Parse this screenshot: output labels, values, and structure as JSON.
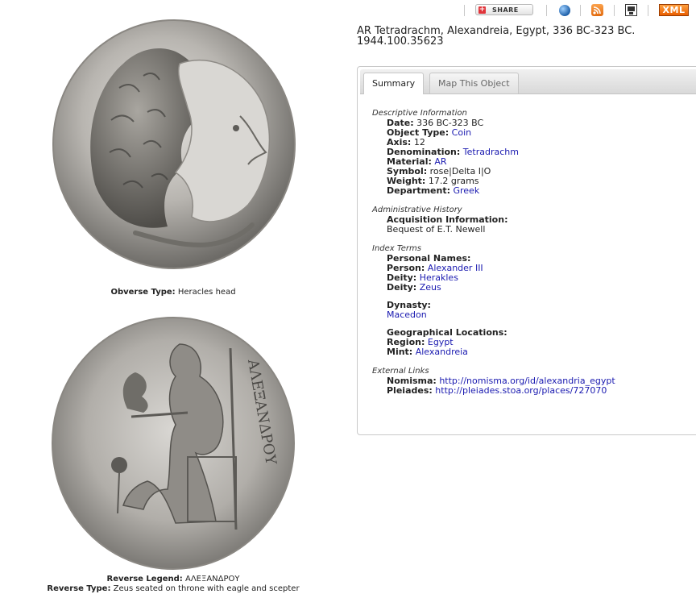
{
  "toolbar": {
    "share_label": "SHARE",
    "xml_label": "XML",
    "icons": [
      "share-icon",
      "globe-icon",
      "rss-icon",
      "kml-icon",
      "xml-icon"
    ]
  },
  "object": {
    "title": "AR Tetradrachm, Alexandreia, Egypt, 336 BC-323 BC.",
    "accession": "1944.100.35623"
  },
  "images": {
    "obverse_caption_label": "Obverse Type:",
    "obverse_caption_value": "Heracles head",
    "reverse_legend_label": "Reverse Legend:",
    "reverse_legend_value": "ΑΛΕΞΑΝΔΡΟΥ",
    "reverse_type_label": "Reverse Type:",
    "reverse_type_value": "Zeus seated on throne with eagle and scepter"
  },
  "tabs": [
    {
      "label": "Summary",
      "active": true
    },
    {
      "label": "Map This Object",
      "active": false
    }
  ],
  "summary": {
    "descriptive": {
      "heading": "Descriptive Information",
      "date_label": "Date:",
      "date": "336 BC-323 BC",
      "object_type_label": "Object Type:",
      "object_type": "Coin",
      "axis_label": "Axis:",
      "axis": "12",
      "denomination_label": "Denomination:",
      "denomination": "Tetradrachm",
      "material_label": "Material:",
      "material": "AR",
      "symbol_label": "Symbol:",
      "symbol": "rose|Delta I|O",
      "weight_label": "Weight:",
      "weight": "17.2 grams",
      "department_label": "Department:",
      "department": "Greek"
    },
    "administrative": {
      "heading": "Administrative History",
      "acquisition_label": "Acquisition Information:",
      "acquisition": "Bequest of E.T. Newell"
    },
    "index_terms": {
      "heading": "Index Terms",
      "personal_names_label": "Personal Names:",
      "person_label": "Person:",
      "person": "Alexander III",
      "deity1_label": "Deity:",
      "deity1": "Herakles",
      "deity2_label": "Deity:",
      "deity2": "Zeus",
      "dynasty_label": "Dynasty:",
      "dynasty": "Macedon",
      "geo_label": "Geographical Locations:",
      "region_label": "Region:",
      "region": "Egypt",
      "mint_label": "Mint:",
      "mint": "Alexandreia"
    },
    "external": {
      "heading": "External Links",
      "nomisma_label": "Nomisma:",
      "nomisma": "http://nomisma.org/id/alexandria_egypt",
      "pleiades_label": "Pleiades:",
      "pleiades": "http://pleiades.stoa.org/places/727070"
    }
  },
  "colors": {
    "link": "#1a1ab0",
    "coin_silver_light": "#d8d6d2",
    "coin_silver_dark": "#5b5a57"
  }
}
